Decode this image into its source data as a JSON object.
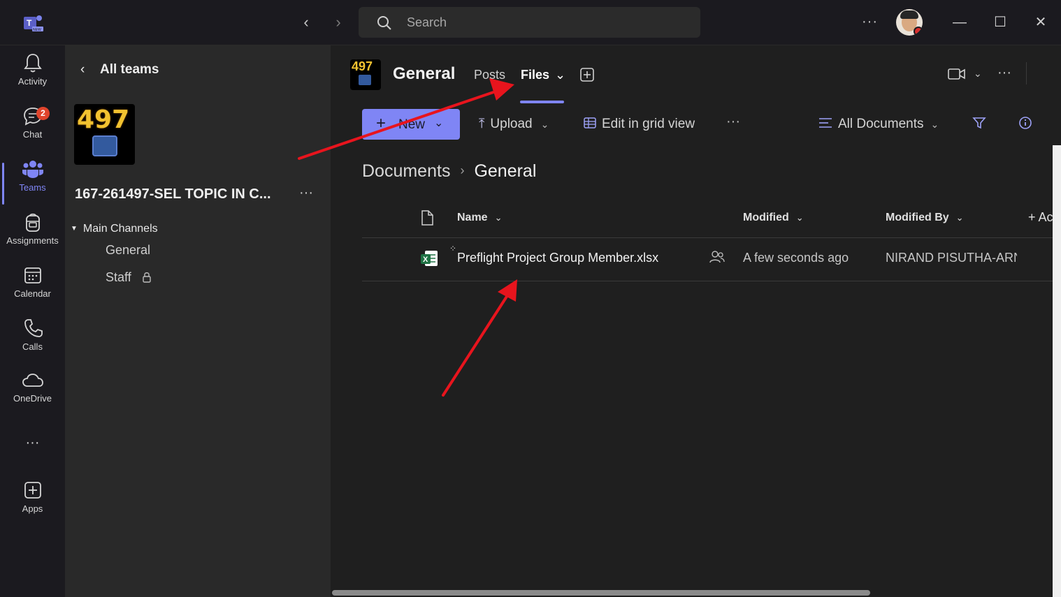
{
  "titlebar": {
    "search_placeholder": "Search",
    "more": "···"
  },
  "rail": {
    "items": [
      {
        "label": "Activity"
      },
      {
        "label": "Chat",
        "badge": "2"
      },
      {
        "label": "Teams"
      },
      {
        "label": "Assignments"
      },
      {
        "label": "Calendar"
      },
      {
        "label": "Calls"
      },
      {
        "label": "OneDrive"
      },
      {
        "label": "···"
      },
      {
        "label": "Apps"
      }
    ],
    "active_color": "#7f85f5"
  },
  "teampane": {
    "back_label": "All teams",
    "team_avatar_text": "497",
    "team_name": "167-261497-SEL TOPIC IN C...",
    "more": "···",
    "section_label": "Main Channels",
    "channels": [
      {
        "name": "General"
      },
      {
        "name": "Staff"
      }
    ]
  },
  "channel": {
    "avatar_text": "497",
    "title": "General",
    "tabs": [
      {
        "label": "Posts"
      },
      {
        "label": "Files"
      }
    ],
    "more": "···"
  },
  "toolbar": {
    "new_label": "New",
    "upload_label": "Upload",
    "grid_label": "Edit in grid view",
    "more": "···",
    "view_label": "All Documents"
  },
  "breadcrumb": {
    "root": "Documents",
    "current": "General"
  },
  "table": {
    "columns": {
      "name": "Name",
      "modified": "Modified",
      "modified_by": "Modified By",
      "add": "+ Ac"
    },
    "rows": [
      {
        "name": "Preflight Project Group Member.xlsx",
        "modified": "A few seconds ago",
        "modified_by": "NIRAND PISUTHA-ARN"
      }
    ]
  },
  "colors": {
    "accent": "#7f85f5",
    "annotation_arrow": "#e8141d",
    "excel_green": "#1f7244"
  }
}
